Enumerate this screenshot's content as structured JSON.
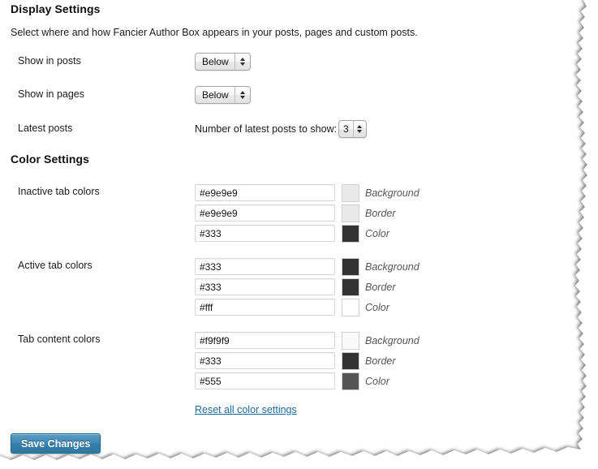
{
  "display_settings": {
    "title": "Display Settings",
    "description": "Select where and how Fancier Author Box appears in your posts, pages and custom posts.",
    "rows": [
      {
        "label": "Show in posts",
        "value": "Below"
      },
      {
        "label": "Show in pages",
        "value": "Below"
      }
    ],
    "latest_posts": {
      "label": "Latest posts",
      "caption": "Number of latest posts to show:",
      "value": "3"
    }
  },
  "color_settings": {
    "title": "Color Settings",
    "groups": [
      {
        "label": "Inactive tab colors",
        "fields": [
          {
            "value": "#e9e9e9",
            "swatch": "#e9e9e9",
            "label": "Background"
          },
          {
            "value": "#e9e9e9",
            "swatch": "#e9e9e9",
            "label": "Border"
          },
          {
            "value": "#333",
            "swatch": "#333333",
            "label": "Color"
          }
        ]
      },
      {
        "label": "Active tab colors",
        "fields": [
          {
            "value": "#333",
            "swatch": "#333333",
            "label": "Background"
          },
          {
            "value": "#333",
            "swatch": "#333333",
            "label": "Border"
          },
          {
            "value": "#fff",
            "swatch": "#ffffff",
            "label": "Color"
          }
        ]
      },
      {
        "label": "Tab content colors",
        "fields": [
          {
            "value": "#f9f9f9",
            "swatch": "#f9f9f9",
            "label": "Background"
          },
          {
            "value": "#333",
            "swatch": "#333333",
            "label": "Border"
          },
          {
            "value": "#555",
            "swatch": "#555555",
            "label": "Color"
          }
        ]
      }
    ],
    "reset_link": "Reset all color settings"
  },
  "footer": {
    "save_label": "Save Changes"
  },
  "theme": {
    "link_color": "#1e6a9e",
    "button_color": "#3f86b2",
    "page_background": "#ffffff"
  }
}
